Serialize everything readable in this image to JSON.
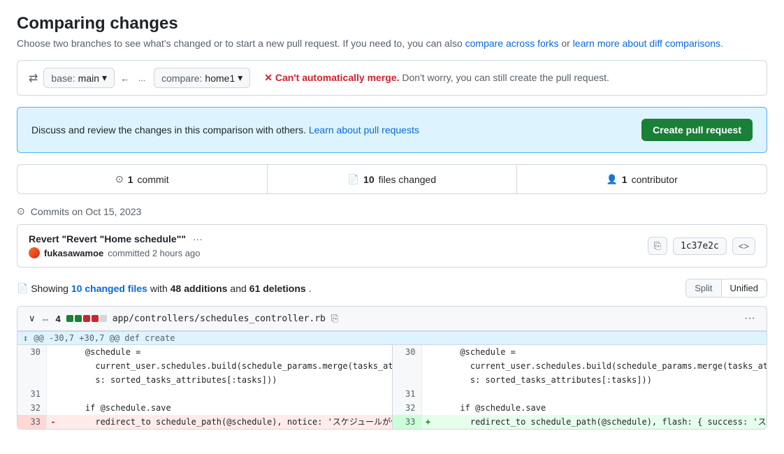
{
  "page": {
    "title": "Comparing changes",
    "subtitle": "Choose two branches to see what's changed or to start a new pull request. If you need to, you can also",
    "compare_across_forks_link": "compare across forks",
    "or_text": "or",
    "learn_more_link": "learn more about diff comparisons",
    "period": "."
  },
  "branch_bar": {
    "switch_icon": "⇄",
    "base_label": "base:",
    "base_branch": "main",
    "arrow": "←",
    "more_btn": "...",
    "compare_label": "compare:",
    "compare_branch": "home1",
    "merge_warning": "✕ Can't automatically merge.",
    "merge_text": "Don't worry, you can still create the pull request."
  },
  "info_box": {
    "text": "Discuss and review the changes in this comparison with others.",
    "link_text": "Learn about pull requests",
    "button_label": "Create pull request"
  },
  "stats": [
    {
      "icon": "⊙",
      "count": "1",
      "label": "commit"
    },
    {
      "icon": "📄",
      "count": "10",
      "label": "files changed"
    },
    {
      "icon": "👤",
      "count": "1",
      "label": "contributor"
    }
  ],
  "commits_section": {
    "header_icon": "⊙",
    "header_text": "Commits on Oct 15, 2023",
    "commit": {
      "title": "Revert \"Revert \"Home schedule\"\"",
      "ellipsis": "···",
      "author": "fukasawamoe",
      "time": "committed 2 hours ago",
      "copy_icon": "⎘",
      "hash": "1c37e2c",
      "code_icon": "<>"
    }
  },
  "showing_bar": {
    "icon": "📄",
    "text_before": "Showing",
    "changed_files_count": "10 changed files",
    "text_middle": "with",
    "additions": "48 additions",
    "and": "and",
    "deletions": "61 deletions",
    "period": ".",
    "split_label": "Split",
    "unified_label": "Unified"
  },
  "diff_file": {
    "chevron": "∨",
    "expand_icon": "⇔",
    "count": "4",
    "bars": [
      "green",
      "green",
      "red",
      "red",
      "gray"
    ],
    "filepath": "app/controllers/schedules_controller.rb",
    "copy_icon": "⎘",
    "more_icon": "···",
    "hunk_header": "@@ -30,7 +30,7 @@ def create",
    "left_lines": [
      {
        "num": "30",
        "sign": " ",
        "code": "    @schedule =\n      current_user.schedules.build(schedule_params.merge(tasks_attribute\n      s: sorted_tasks_attributes[:tasks]))",
        "type": "context"
      },
      {
        "num": "31",
        "sign": " ",
        "code": "",
        "type": "context"
      },
      {
        "num": "32",
        "sign": " ",
        "code": "    if @schedule.save",
        "type": "context"
      },
      {
        "num": "33",
        "sign": "-",
        "code": "      redirect_to schedule_path(@schedule), notice: 'スケジュールが作",
        "type": "deletion"
      }
    ],
    "right_lines": [
      {
        "num": "30",
        "sign": " ",
        "code": "    @schedule =\n      current_user.schedules.build(schedule_params.merge(tasks_attribute\n      s: sorted_tasks_attributes[:tasks]))",
        "type": "context"
      },
      {
        "num": "31",
        "sign": " ",
        "code": "",
        "type": "context"
      },
      {
        "num": "32",
        "sign": " ",
        "code": "    if @schedule.save",
        "type": "context"
      },
      {
        "num": "33",
        "sign": "+",
        "code": "      redirect_to schedule_path(@schedule), flash: { success: 'スケ",
        "type": "addition"
      }
    ]
  },
  "colors": {
    "accent_blue": "#0969da",
    "green": "#1a7f37",
    "red": "#cf222e",
    "border": "#d0d7de"
  }
}
